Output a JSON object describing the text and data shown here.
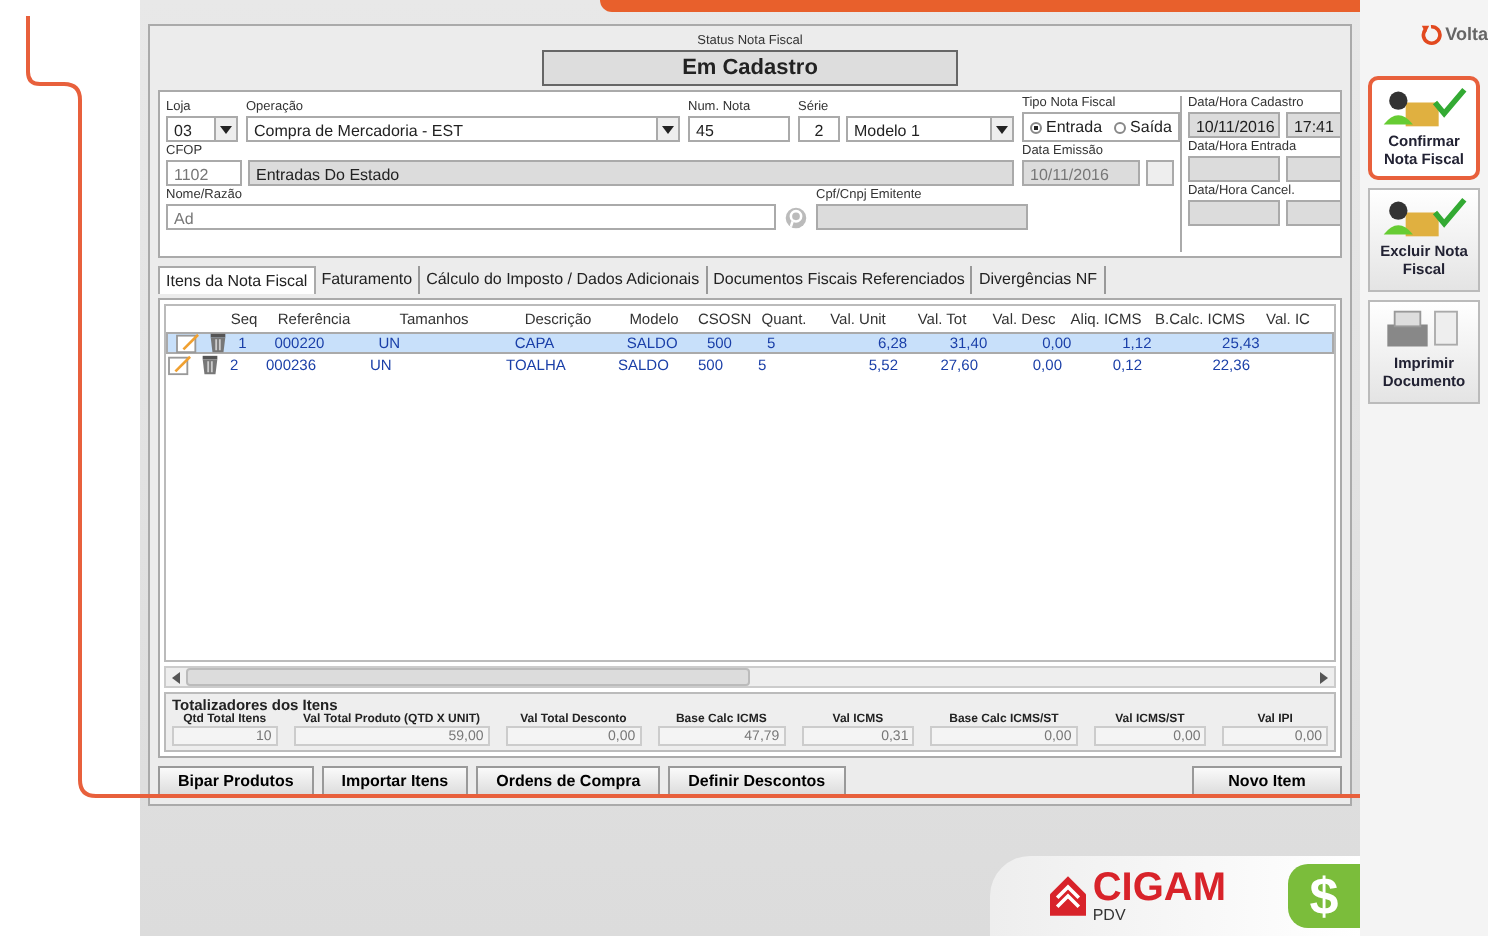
{
  "sidebar": {
    "back": {
      "label": "Volta"
    },
    "actions": [
      {
        "label": "Confirmar Nota Fiscal",
        "kind": "confirm",
        "highlighted": true
      },
      {
        "label": "Excluir Nota Fiscal",
        "kind": "confirm",
        "highlighted": false
      },
      {
        "label": "Imprimir Documento",
        "kind": "print",
        "highlighted": false
      }
    ]
  },
  "status": {
    "label": "Status Nota Fiscal",
    "value": "Em Cadastro"
  },
  "form": {
    "loja": {
      "label": "Loja",
      "value": "03"
    },
    "operacao": {
      "label": "Operação",
      "value": "Compra de Mercadoria - EST"
    },
    "num_nota": {
      "label": "Num. Nota",
      "value": "45"
    },
    "serie": {
      "label": "Série",
      "value": "2",
      "model": "Modelo 1"
    },
    "tipo": {
      "label": "Tipo Nota Fiscal",
      "options": [
        {
          "label": "Entrada",
          "selected": true
        },
        {
          "label": "Saída",
          "selected": false
        }
      ]
    },
    "cfop": {
      "label": "CFOP",
      "value": "1102",
      "description": "Entradas Do Estado"
    },
    "data_emissao": {
      "label": "Data Emissão",
      "value": "10/11/2016"
    },
    "nome": {
      "label": "Nome/Razão",
      "value": "Ad"
    },
    "cpf": {
      "label": "Cpf/Cnpj Emitente"
    },
    "dates": [
      {
        "label": "Data/Hora Cadastro",
        "date": "10/11/2016",
        "time": "17:41"
      },
      {
        "label": "Data/Hora Entrada"
      },
      {
        "label": "Data/Hora Cancel."
      }
    ]
  },
  "tabs": [
    {
      "label": "Itens da Nota Fiscal",
      "selected": true
    },
    {
      "label": "Faturamento",
      "selected": false
    },
    {
      "label": "Cálculo do Imposto / Dados Adicionais",
      "selected": false
    },
    {
      "label": "Documentos Fiscais Referenciados",
      "selected": false
    },
    {
      "label": "Divergências NF",
      "selected": false
    }
  ],
  "table": {
    "columns": [
      "Seq",
      "Referência",
      "Tamanhos",
      "Descrição",
      "Modelo",
      "CSOSN",
      "Quant.",
      "Val. Unit",
      "Val. Tot",
      "Val. Desc",
      "Aliq. ICMS",
      "B.Calc. ICMS",
      "Val. IC"
    ],
    "rows": [
      {
        "selected": true,
        "cells": [
          "1",
          "000220",
          "UN",
          "CAPA",
          "SALDO",
          "500",
          "5",
          "6,28",
          "31,40",
          "0,00",
          "1,12",
          "25,43",
          ""
        ]
      },
      {
        "selected": false,
        "cells": [
          "2",
          "000236",
          "UN",
          "TOALHA",
          "SALDO",
          "500",
          "5",
          "5,52",
          "27,60",
          "0,00",
          "0,12",
          "22,36",
          ""
        ]
      }
    ]
  },
  "totals": {
    "title": "Totalizadores dos Itens",
    "items": [
      {
        "label": "Qtd Total Itens",
        "value": "10"
      },
      {
        "label": "Val Total Produto (QTD X UNIT)",
        "value": "59,00"
      },
      {
        "label": "Val Total Desconto",
        "value": "0,00"
      },
      {
        "label": "Base Calc ICMS",
        "value": "47,79"
      },
      {
        "label": "Val ICMS",
        "value": "0,31"
      },
      {
        "label": "Base Calc ICMS/ST",
        "value": "0,00"
      },
      {
        "label": "Val ICMS/ST",
        "value": "0,00"
      },
      {
        "label": "Val IPI",
        "value": "0,00"
      }
    ]
  },
  "buttons": [
    {
      "label": "Bipar Produtos",
      "kind": "left"
    },
    {
      "label": "Importar Itens",
      "kind": "left"
    },
    {
      "label": "Ordens de Compra",
      "kind": "left"
    },
    {
      "label": "Definir Descontos",
      "kind": "left"
    },
    {
      "label": "Novo Item",
      "kind": "right"
    }
  ],
  "logo": {
    "name": "CIGAM",
    "sub": "PDV",
    "badge": "$"
  }
}
